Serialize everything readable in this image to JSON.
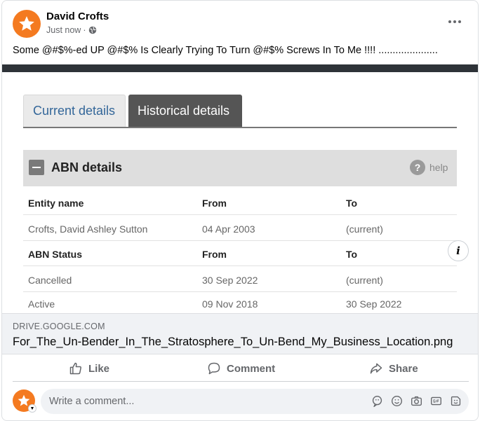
{
  "post": {
    "author": "David Crofts",
    "timestamp": "Just now",
    "separator": "·",
    "audience_icon": "globe-icon",
    "more_icon": "more-dots-icon",
    "text": "Some @#$%-ed UP @#$% Is Clearly Trying To Turn @#$% Screws In To Me !!!! .....................",
    "avatar_color": "#f47a20"
  },
  "screenshot": {
    "tabs": [
      {
        "label": "Current details",
        "active": false
      },
      {
        "label": "Historical details",
        "active": true
      }
    ],
    "panel": {
      "title": "ABN details",
      "help_label": "help",
      "help_glyph": "?"
    },
    "rows": [
      {
        "cells": [
          "Entity name",
          "From",
          "To"
        ],
        "header": true
      },
      {
        "cells": [
          "Crofts, David Ashley Sutton",
          "04 Apr 2003",
          "(current)"
        ],
        "header": false
      },
      {
        "cells": [
          "ABN Status",
          "From",
          "To"
        ],
        "header": true
      },
      {
        "cells": [
          "Cancelled",
          "30 Sep 2022",
          "(current)"
        ],
        "header": false
      },
      {
        "cells": [
          "Active",
          "09 Nov 2018",
          "30 Sep 2022"
        ],
        "header": false
      }
    ],
    "info_glyph": "i"
  },
  "link": {
    "domain": "DRIVE.GOOGLE.COM",
    "title": "For_The_Un-Bender_In_The_Stratosphere_To_Un-Bend_My_Business_Location.png"
  },
  "actions": {
    "like": "Like",
    "comment": "Comment",
    "share": "Share"
  },
  "comment_box": {
    "placeholder": "Write a comment...",
    "icons": [
      "sticker-avatar-icon",
      "emoji-icon",
      "camera-icon",
      "gif-icon",
      "sticker-icon"
    ]
  }
}
